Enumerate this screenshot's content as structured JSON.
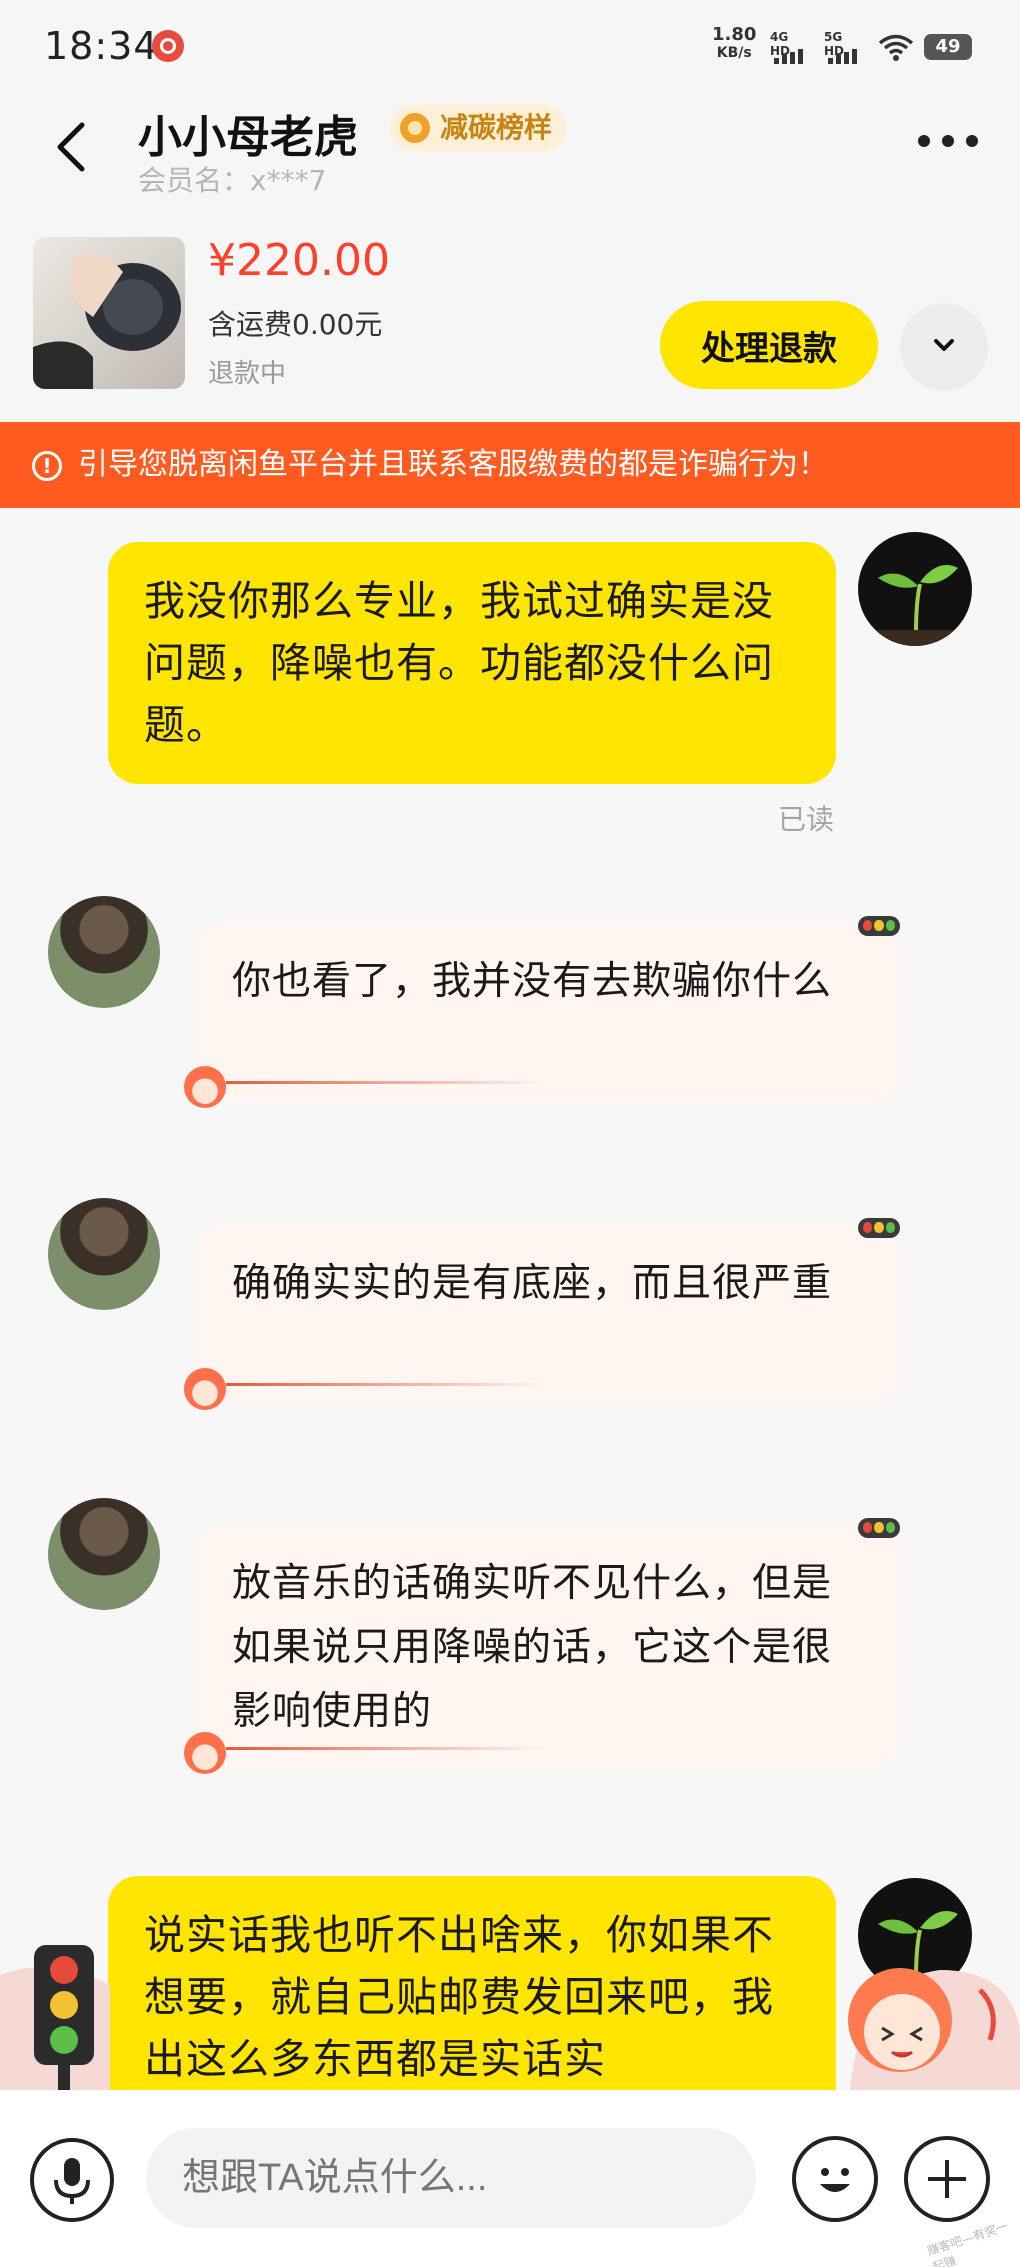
{
  "status_bar": {
    "time": "18:34",
    "net_speed": "1.80",
    "net_unit": "KB/s",
    "sim1": "4G HD",
    "sim2": "5G HD",
    "battery": "49"
  },
  "header": {
    "seller_name": "小小母老虎",
    "badge": "减碳榜样",
    "member": "会员名：x***7"
  },
  "product": {
    "price": "¥220.00",
    "shipping": "含运费0.00元",
    "status": "退款中",
    "process_button": "处理退款"
  },
  "warning": "引导您脱离闲鱼平台并且联系客服缴费的都是诈骗行为！",
  "messages": [
    {
      "side": "me",
      "text": "我没你那么专业，我试过确实是没问题，降噪也有。功能都没什么问题。",
      "status": "已读"
    },
    {
      "side": "other",
      "text": "你也看了，我并没有去欺骗你什么"
    },
    {
      "side": "other",
      "text": "确确实实的是有底座，而且很严重"
    },
    {
      "side": "other",
      "text": "放音乐的话确实听不见什么，但是如果说只用降噪的话，它这个是很影响使用的"
    },
    {
      "side": "me",
      "text": "说实话我也听不出啥来，你如果不想要，就自己贴邮费发回来吧，我出这么多东西都是实话实"
    }
  ],
  "input": {
    "placeholder": "想跟TA说点什么..."
  },
  "watermark": "赚客吧—有奖一起赚",
  "colors": {
    "accent_yellow": "#ffe500",
    "price_red": "#ff3f2a",
    "warning_orange": "#ff5a1f",
    "incoming_bubble": "#fff5f1"
  }
}
